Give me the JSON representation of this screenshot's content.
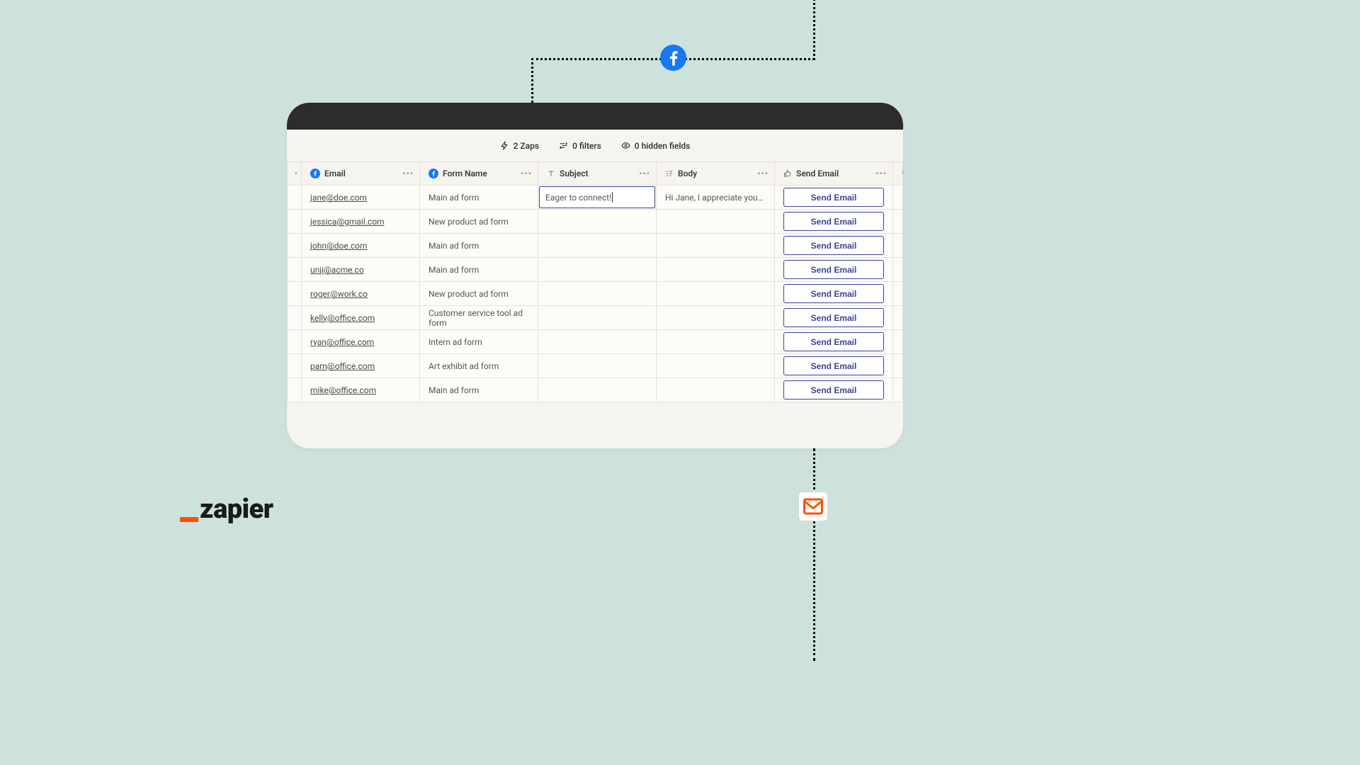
{
  "brand": {
    "name": "zapier"
  },
  "toolbar": {
    "zaps": "2 Zaps",
    "filters": "0 filters",
    "hidden": "0 hidden fields"
  },
  "columns": {
    "email": "Email",
    "form": "Form Name",
    "subject": "Subject",
    "body": "Body",
    "send": "Send Email"
  },
  "send_button_label": "Send Email",
  "rows": [
    {
      "email": "jane@doe.com",
      "form": "Main ad form",
      "subject": "Eager to connect!",
      "body": "Hi Jane, I appreciate your inte…",
      "editing": true
    },
    {
      "email": "jessica@gmail.com",
      "form": "New product ad form",
      "subject": "",
      "body": ""
    },
    {
      "email": "john@doe.com",
      "form": "Main ad form",
      "subject": "",
      "body": ""
    },
    {
      "email": "unji@acme.co",
      "form": "Main ad form",
      "subject": "",
      "body": ""
    },
    {
      "email": "roger@work.co",
      "form": "New product ad form",
      "subject": "",
      "body": ""
    },
    {
      "email": "kelly@office.com",
      "form": "Customer service tool ad form",
      "subject": "",
      "body": ""
    },
    {
      "email": "ryan@office.com",
      "form": "Intern ad form",
      "subject": "",
      "body": ""
    },
    {
      "email": "pam@office.com",
      "form": "Art exhibit ad form",
      "subject": "",
      "body": ""
    },
    {
      "email": "mike@office.com",
      "form": "Main ad form",
      "subject": "",
      "body": ""
    }
  ]
}
